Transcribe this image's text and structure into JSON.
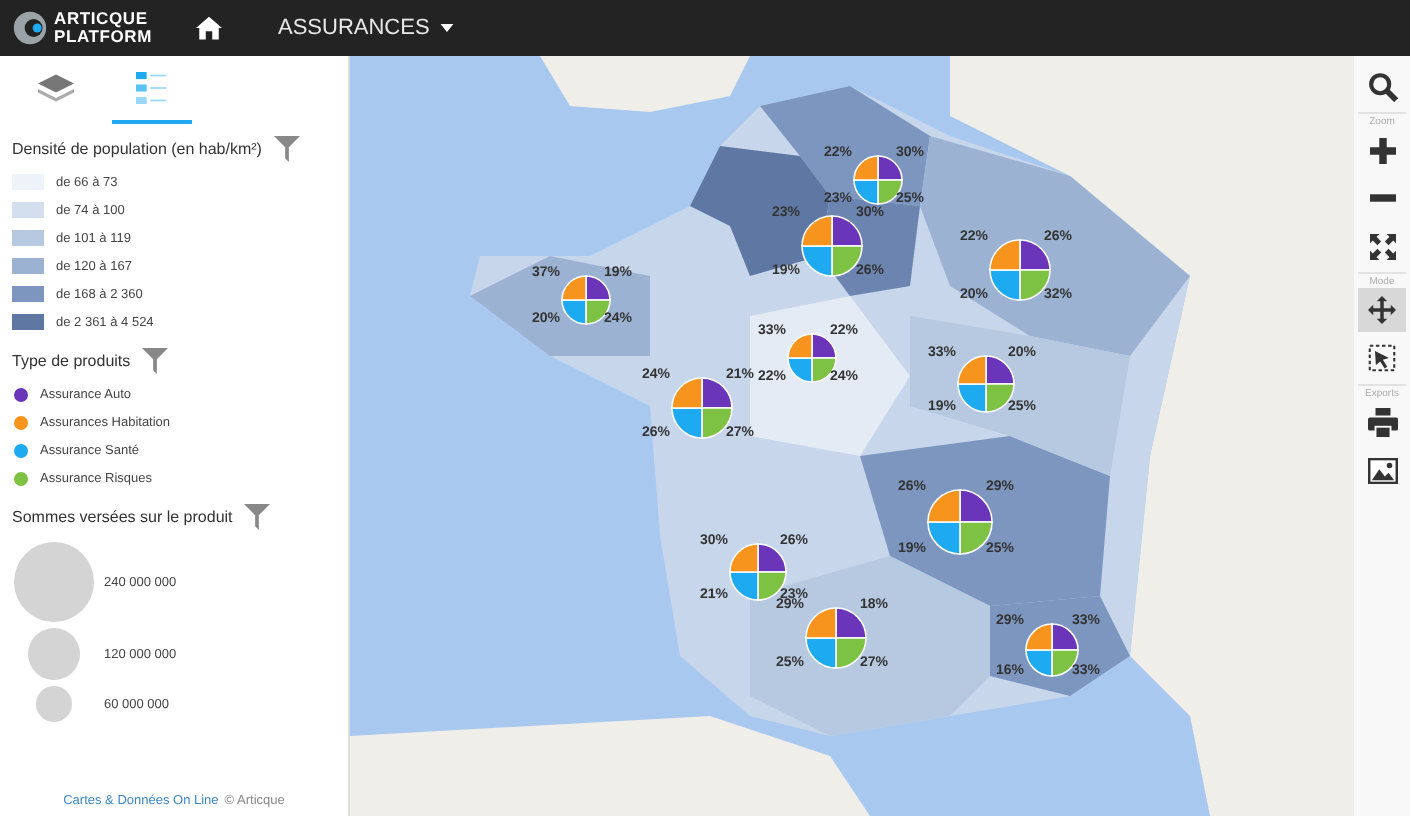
{
  "header": {
    "logo_line_1": "ARTICQUE",
    "logo_line_2": "PLATFORM",
    "menu": "ASSURANCES"
  },
  "sidebar": {
    "tabs": [
      {
        "kind": "layers",
        "selected": false
      },
      {
        "kind": "legend",
        "selected": true
      }
    ],
    "density": {
      "title": "Densité de population (en hab/km²)",
      "classes": [
        {
          "label": "de 66 à 73",
          "color": "#eef3fa"
        },
        {
          "label": "de 74 à 100",
          "color": "#d3dfee"
        },
        {
          "label": "de 101 à 119",
          "color": "#b6c9e0"
        },
        {
          "label": "de 120 à 167",
          "color": "#9cb2d3"
        },
        {
          "label": "de 168 à 2 360",
          "color": "#7d96c0"
        },
        {
          "label": "de 2 361 à 4 524",
          "color": "#5f77a3"
        }
      ]
    },
    "products": {
      "title": "Type de produits",
      "items": [
        {
          "label": "Assurance Auto",
          "color": "#6a35b8"
        },
        {
          "label": "Assurances Habitation",
          "color": "#f7941d"
        },
        {
          "label": "Assurance Santé",
          "color": "#1eaaf1"
        },
        {
          "label": "Assurance Risques",
          "color": "#7dc243"
        }
      ]
    },
    "sums": {
      "title": "Sommes versées sur le produit",
      "items": [
        {
          "label": "240 000 000"
        },
        {
          "label": "120 000 000"
        },
        {
          "label": "60 000 000"
        }
      ]
    },
    "footer": {
      "link": "Cartes & Données On Line",
      "copyright": "© Articque"
    }
  },
  "map": {
    "pies": [
      {
        "labels": [
          "22%",
          "30%",
          "23%",
          "25%"
        ]
      },
      {
        "labels": [
          "23%",
          "30%",
          "19%",
          "26%"
        ]
      },
      {
        "labels": [
          "22%",
          "26%",
          "20%",
          "32%"
        ]
      },
      {
        "labels": [
          "37%",
          "19%",
          "20%",
          "24%"
        ]
      },
      {
        "labels": [
          "33%",
          "22%",
          "22%",
          "24%"
        ]
      },
      {
        "labels": [
          "33%",
          "20%",
          "19%",
          "25%"
        ]
      },
      {
        "labels": [
          "24%",
          "21%",
          "26%",
          "27%"
        ]
      },
      {
        "labels": [
          "26%",
          "29%",
          "19%",
          "25%"
        ]
      },
      {
        "labels": [
          "30%",
          "26%",
          "21%",
          "23%"
        ]
      },
      {
        "labels": [
          "29%",
          "18%",
          "25%",
          "27%"
        ]
      },
      {
        "labels": [
          "29%",
          "33%",
          "16%",
          "33%"
        ]
      }
    ]
  },
  "toolbar": {
    "items": [
      {
        "kind": "search"
      },
      {
        "kind": "heading",
        "label": "Zoom"
      },
      {
        "kind": "zoom-in"
      },
      {
        "kind": "zoom-out"
      },
      {
        "kind": "fullscreen"
      },
      {
        "kind": "heading",
        "label": "Mode"
      },
      {
        "kind": "pan",
        "selected": true
      },
      {
        "kind": "select",
        "selected": false
      },
      {
        "kind": "heading",
        "label": "Exports"
      },
      {
        "kind": "print"
      },
      {
        "kind": "image"
      }
    ]
  }
}
